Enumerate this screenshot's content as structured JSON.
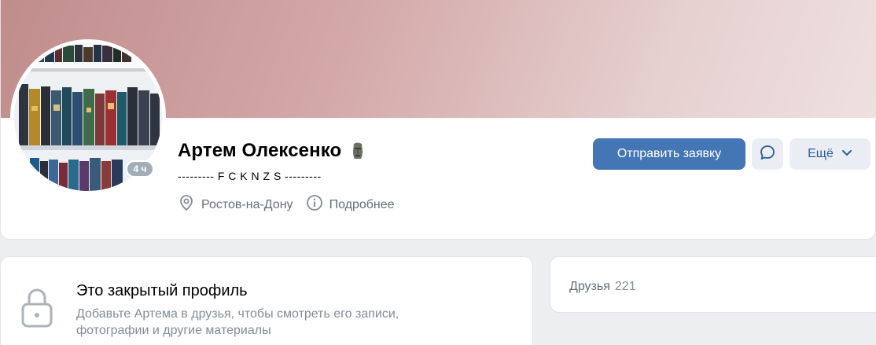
{
  "profile": {
    "name": "Артем Олексенко",
    "status": "--------- F C K N Z S ---------",
    "last_seen_badge": "4 ч",
    "city": "Ростов-на-Дону",
    "details_label": "Подробнее"
  },
  "actions": {
    "send_request_label": "Отправить заявку",
    "more_label": "Ещё"
  },
  "closed_profile": {
    "title": "Это закрытый профиль",
    "description": "Добавьте Артема в друзья, чтобы смотреть его записи, фотографии и другие материалы"
  },
  "friends": {
    "label": "Друзья",
    "count": "221"
  },
  "colors": {
    "primary_button": "#4475b4",
    "secondary_button": "#eaeef4",
    "accent_text": "#2c5d98",
    "muted_text": "#818c99"
  },
  "icons": {
    "status": "moai-icon",
    "city": "location-pin-icon",
    "details": "info-icon",
    "message": "message-bubble-icon",
    "more": "chevron-down-icon",
    "closed": "lock-icon"
  }
}
